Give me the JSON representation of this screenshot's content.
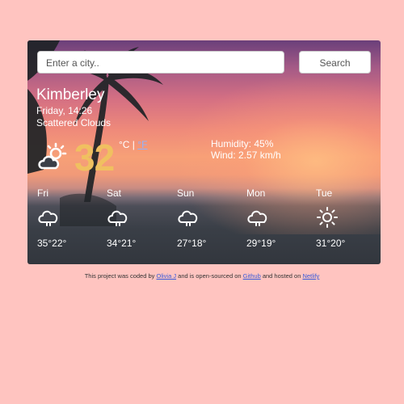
{
  "search": {
    "placeholder": "Enter a city..",
    "button_label": "Search"
  },
  "current": {
    "city": "Kimberley",
    "datetime": "Friday, 14:26",
    "description": "Scattered Clouds",
    "icon": "cloud-sun-icon",
    "temperature": "32",
    "unit_celsius": "°C",
    "unit_separator": " | ",
    "unit_fahrenheit": "°F",
    "humidity": "Humidity: 45%",
    "wind": "Wind: 2.57 km/h"
  },
  "forecast": [
    {
      "day": "Fri",
      "icon": "cloud-icon",
      "temps": "35°22°"
    },
    {
      "day": "Sat",
      "icon": "cloud-icon",
      "temps": "34°21°"
    },
    {
      "day": "Sun",
      "icon": "cloud-icon",
      "temps": "27°18°"
    },
    {
      "day": "Mon",
      "icon": "cloud-icon",
      "temps": "29°19°"
    },
    {
      "day": "Tue",
      "icon": "sun-icon",
      "temps": "31°20°"
    }
  ],
  "footer": {
    "text1": "This project was coded by ",
    "author_link": "Olivia J",
    "text2": " and is open-sourced on ",
    "github_link": "Github",
    "text3": " and hosted on ",
    "netlify_link": "Netlify"
  },
  "colors": {
    "background": "#ffc4c0",
    "temperature": "#f0c060",
    "link": "#3a5bd9"
  }
}
